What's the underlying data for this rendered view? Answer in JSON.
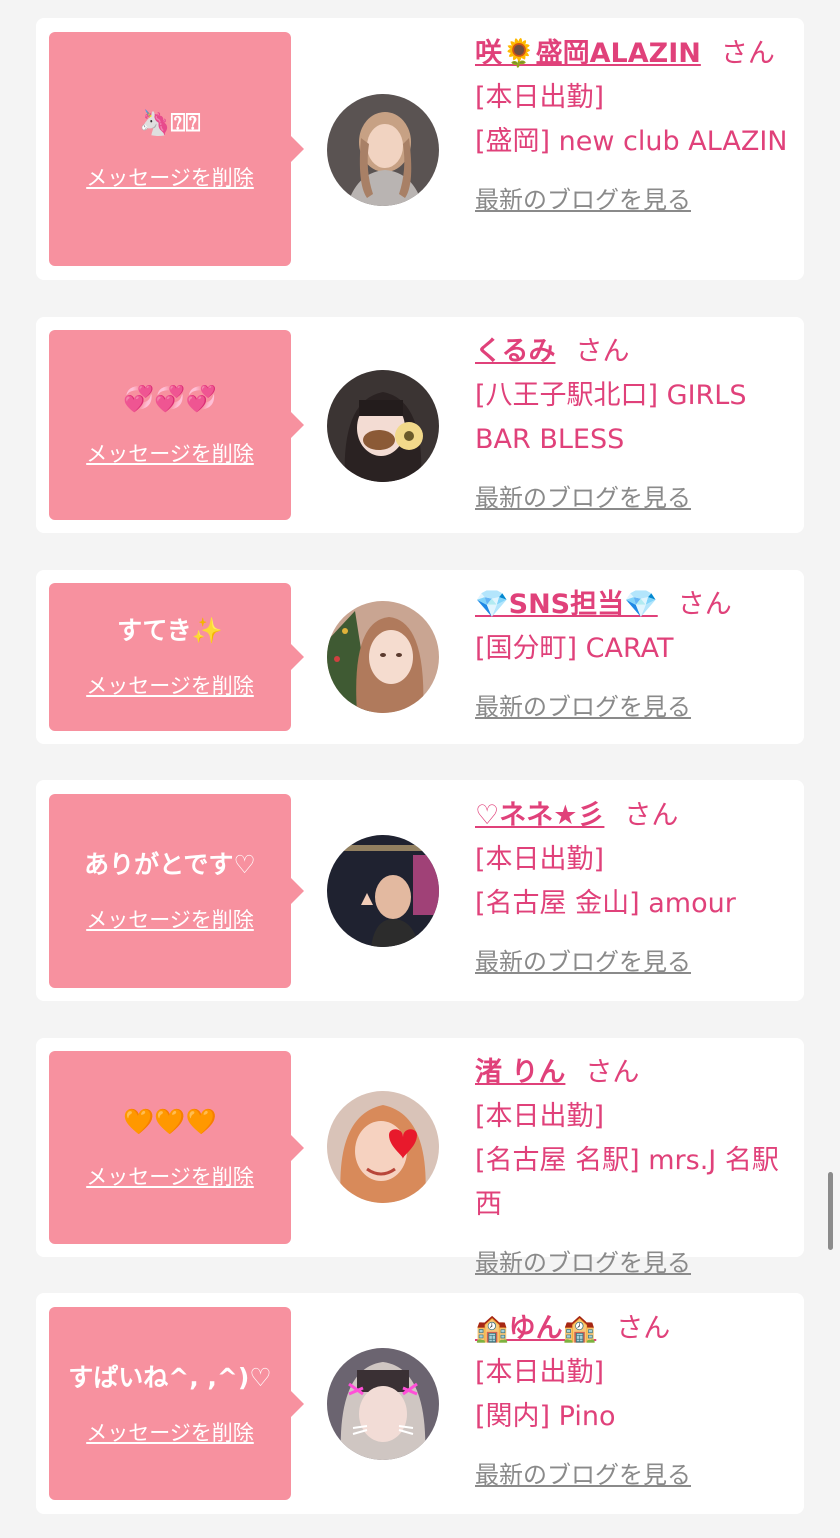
{
  "delete_label": "メッセージを削除",
  "blog_label": "最新のブログを見る",
  "san_label": "さん",
  "items": [
    {
      "message": "🦄⍰⍰",
      "name": "咲🌻盛岡ALAZIN",
      "status": "[本日出勤]",
      "shop": "[盛岡] new club ALAZIN"
    },
    {
      "message": "💞💞💞",
      "name": "くるみ",
      "status": "",
      "shop": "[八王子駅北口] GIRLS BAR BLESS"
    },
    {
      "message": "すてき✨",
      "name": "💎SNS担当💎",
      "status": "",
      "shop": "[国分町] CARAT"
    },
    {
      "message": "ありがとです♡",
      "name": "♡ネネ★彡",
      "status": "[本日出勤]",
      "shop": "[名古屋 金山] amour"
    },
    {
      "message": "🧡🧡🧡",
      "name": "渚 りん",
      "status": "[本日出勤]",
      "shop": "[名古屋 名駅] mrs.J 名駅西"
    },
    {
      "message": "すぱいね^, ,^)♡",
      "name": "🏫ゆん🏫",
      "status": "[本日出勤]",
      "shop": "[関内] Pino"
    }
  ],
  "colors": {
    "bubble": "#f7919f",
    "accent": "#e0417a",
    "link_gray": "#8a8a8a",
    "background": "#f4f4f4"
  }
}
